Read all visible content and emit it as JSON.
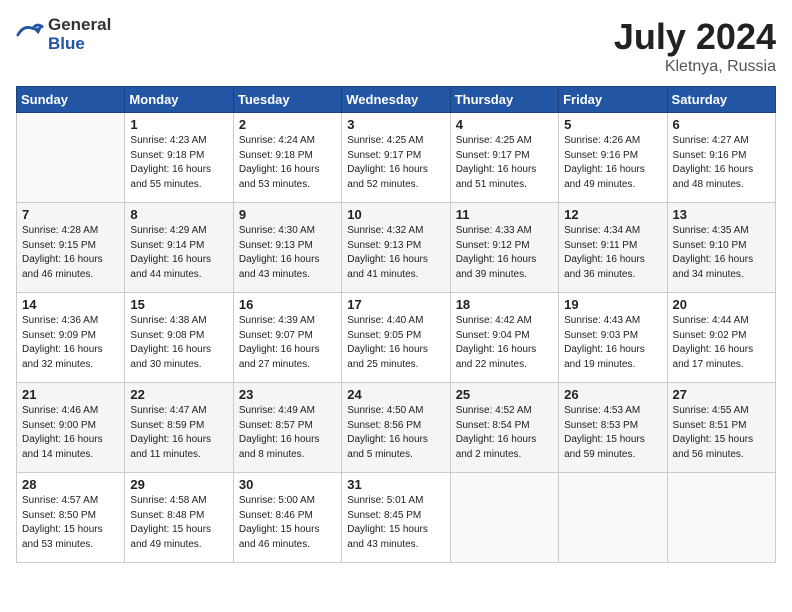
{
  "header": {
    "logo_general": "General",
    "logo_blue": "Blue",
    "title": "July 2024",
    "location": "Kletnya, Russia"
  },
  "days_of_week": [
    "Sunday",
    "Monday",
    "Tuesday",
    "Wednesday",
    "Thursday",
    "Friday",
    "Saturday"
  ],
  "weeks": [
    [
      {
        "num": "",
        "empty": true
      },
      {
        "num": "1",
        "sunrise": "4:23 AM",
        "sunset": "9:18 PM",
        "daylight": "16 hours and 55 minutes."
      },
      {
        "num": "2",
        "sunrise": "4:24 AM",
        "sunset": "9:18 PM",
        "daylight": "16 hours and 53 minutes."
      },
      {
        "num": "3",
        "sunrise": "4:25 AM",
        "sunset": "9:17 PM",
        "daylight": "16 hours and 52 minutes."
      },
      {
        "num": "4",
        "sunrise": "4:25 AM",
        "sunset": "9:17 PM",
        "daylight": "16 hours and 51 minutes."
      },
      {
        "num": "5",
        "sunrise": "4:26 AM",
        "sunset": "9:16 PM",
        "daylight": "16 hours and 49 minutes."
      },
      {
        "num": "6",
        "sunrise": "4:27 AM",
        "sunset": "9:16 PM",
        "daylight": "16 hours and 48 minutes."
      }
    ],
    [
      {
        "num": "7",
        "sunrise": "4:28 AM",
        "sunset": "9:15 PM",
        "daylight": "16 hours and 46 minutes."
      },
      {
        "num": "8",
        "sunrise": "4:29 AM",
        "sunset": "9:14 PM",
        "daylight": "16 hours and 44 minutes."
      },
      {
        "num": "9",
        "sunrise": "4:30 AM",
        "sunset": "9:13 PM",
        "daylight": "16 hours and 43 minutes."
      },
      {
        "num": "10",
        "sunrise": "4:32 AM",
        "sunset": "9:13 PM",
        "daylight": "16 hours and 41 minutes."
      },
      {
        "num": "11",
        "sunrise": "4:33 AM",
        "sunset": "9:12 PM",
        "daylight": "16 hours and 39 minutes."
      },
      {
        "num": "12",
        "sunrise": "4:34 AM",
        "sunset": "9:11 PM",
        "daylight": "16 hours and 36 minutes."
      },
      {
        "num": "13",
        "sunrise": "4:35 AM",
        "sunset": "9:10 PM",
        "daylight": "16 hours and 34 minutes."
      }
    ],
    [
      {
        "num": "14",
        "sunrise": "4:36 AM",
        "sunset": "9:09 PM",
        "daylight": "16 hours and 32 minutes."
      },
      {
        "num": "15",
        "sunrise": "4:38 AM",
        "sunset": "9:08 PM",
        "daylight": "16 hours and 30 minutes."
      },
      {
        "num": "16",
        "sunrise": "4:39 AM",
        "sunset": "9:07 PM",
        "daylight": "16 hours and 27 minutes."
      },
      {
        "num": "17",
        "sunrise": "4:40 AM",
        "sunset": "9:05 PM",
        "daylight": "16 hours and 25 minutes."
      },
      {
        "num": "18",
        "sunrise": "4:42 AM",
        "sunset": "9:04 PM",
        "daylight": "16 hours and 22 minutes."
      },
      {
        "num": "19",
        "sunrise": "4:43 AM",
        "sunset": "9:03 PM",
        "daylight": "16 hours and 19 minutes."
      },
      {
        "num": "20",
        "sunrise": "4:44 AM",
        "sunset": "9:02 PM",
        "daylight": "16 hours and 17 minutes."
      }
    ],
    [
      {
        "num": "21",
        "sunrise": "4:46 AM",
        "sunset": "9:00 PM",
        "daylight": "16 hours and 14 minutes."
      },
      {
        "num": "22",
        "sunrise": "4:47 AM",
        "sunset": "8:59 PM",
        "daylight": "16 hours and 11 minutes."
      },
      {
        "num": "23",
        "sunrise": "4:49 AM",
        "sunset": "8:57 PM",
        "daylight": "16 hours and 8 minutes."
      },
      {
        "num": "24",
        "sunrise": "4:50 AM",
        "sunset": "8:56 PM",
        "daylight": "16 hours and 5 minutes."
      },
      {
        "num": "25",
        "sunrise": "4:52 AM",
        "sunset": "8:54 PM",
        "daylight": "16 hours and 2 minutes."
      },
      {
        "num": "26",
        "sunrise": "4:53 AM",
        "sunset": "8:53 PM",
        "daylight": "15 hours and 59 minutes."
      },
      {
        "num": "27",
        "sunrise": "4:55 AM",
        "sunset": "8:51 PM",
        "daylight": "15 hours and 56 minutes."
      }
    ],
    [
      {
        "num": "28",
        "sunrise": "4:57 AM",
        "sunset": "8:50 PM",
        "daylight": "15 hours and 53 minutes."
      },
      {
        "num": "29",
        "sunrise": "4:58 AM",
        "sunset": "8:48 PM",
        "daylight": "15 hours and 49 minutes."
      },
      {
        "num": "30",
        "sunrise": "5:00 AM",
        "sunset": "8:46 PM",
        "daylight": "15 hours and 46 minutes."
      },
      {
        "num": "31",
        "sunrise": "5:01 AM",
        "sunset": "8:45 PM",
        "daylight": "15 hours and 43 minutes."
      },
      {
        "num": "",
        "empty": true
      },
      {
        "num": "",
        "empty": true
      },
      {
        "num": "",
        "empty": true
      }
    ]
  ],
  "labels": {
    "sunrise": "Sunrise:",
    "sunset": "Sunset:",
    "daylight": "Daylight:"
  }
}
